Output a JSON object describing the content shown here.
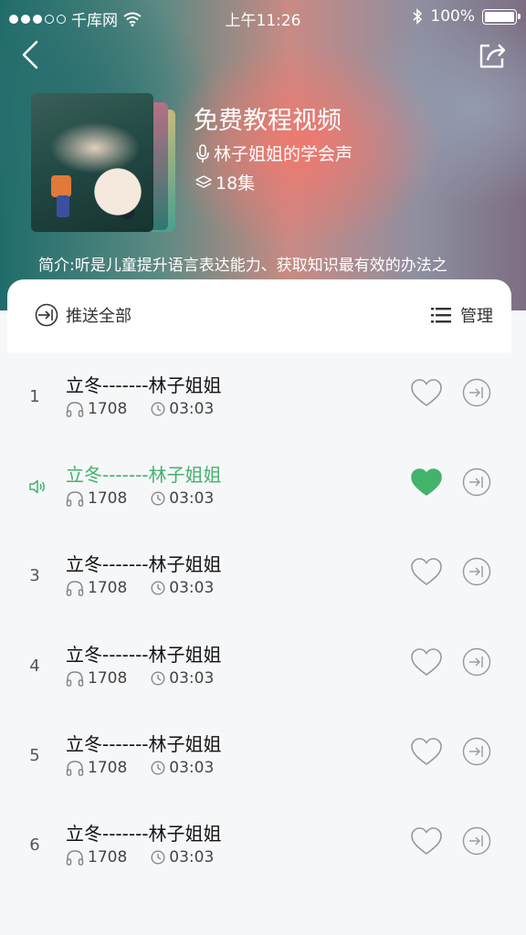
{
  "status_bar": {
    "carrier": "千库网",
    "time": "上午11:26",
    "battery": "100%"
  },
  "album": {
    "title": "免费教程视频",
    "author": "林子姐姐的学会声",
    "episodes": "18集",
    "intro": "简介:听是儿童提升语言表达能力、获取知识最有效的办法之"
  },
  "toolbar": {
    "push_all": "推送全部",
    "manage": "管理"
  },
  "tracks": [
    {
      "num": "1",
      "title": "立冬-------林子姐姐",
      "plays": "1708",
      "duration": "03:03",
      "liked": false,
      "playing": false
    },
    {
      "num": "",
      "title": "立冬-------林子姐姐",
      "plays": "1708",
      "duration": "03:03",
      "liked": true,
      "playing": true
    },
    {
      "num": "3",
      "title": "立冬-------林子姐姐",
      "plays": "1708",
      "duration": "03:03",
      "liked": false,
      "playing": false
    },
    {
      "num": "4",
      "title": "立冬-------林子姐姐",
      "plays": "1708",
      "duration": "03:03",
      "liked": false,
      "playing": false
    },
    {
      "num": "5",
      "title": "立冬-------林子姐姐",
      "plays": "1708",
      "duration": "03:03",
      "liked": false,
      "playing": false
    },
    {
      "num": "6",
      "title": "立冬-------林子姐姐",
      "plays": "1708",
      "duration": "03:03",
      "liked": false,
      "playing": false
    }
  ],
  "colors": {
    "accent": "#43b26b",
    "icon_gray": "#999999"
  },
  "icons": {
    "back": "chevron-left-icon",
    "share": "share-icon",
    "mic": "microphone-icon",
    "layers": "layers-icon",
    "push": "push-icon",
    "list": "list-icon",
    "headphones": "headphones-icon",
    "clock": "clock-icon",
    "heart": "heart-icon",
    "speaker": "speaker-icon"
  }
}
